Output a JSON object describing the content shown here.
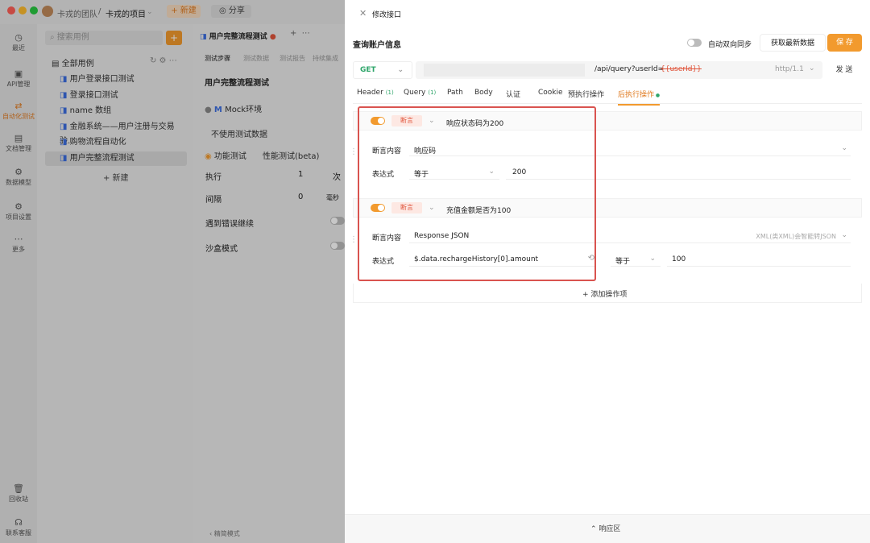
{
  "window": {
    "breadcrumb_team": "卡戎的团队",
    "breadcrumb_sep": "/",
    "project": "卡戎的项目",
    "new_btn": "+ 新建",
    "share_btn": "分享",
    "share_icon": "share-icon"
  },
  "rail": {
    "items": [
      {
        "label": "最近",
        "icon": "clock-icon",
        "glyph": "◷"
      },
      {
        "label": "API管理",
        "icon": "api-icon",
        "glyph": "▣"
      },
      {
        "label": "自动化测试",
        "icon": "auto-test-icon",
        "glyph": "⇄"
      },
      {
        "label": "文档管理",
        "icon": "doc-icon",
        "glyph": "▤"
      },
      {
        "label": "数据模型",
        "icon": "model-icon",
        "glyph": "⚙"
      },
      {
        "label": "项目设置",
        "icon": "settings-icon",
        "glyph": "⚙"
      },
      {
        "label": "更多",
        "icon": "more-icon",
        "glyph": "⋯"
      },
      {
        "label": "回收站",
        "icon": "trash-icon",
        "glyph": "🗑"
      },
      {
        "label": "联系客服",
        "icon": "support-icon",
        "glyph": "☊"
      }
    ]
  },
  "tree": {
    "search_placeholder": "搜索用例",
    "add": "+",
    "root": "全部用例",
    "items": [
      "用户登录接口测试",
      "登录接口测试",
      "name 数组",
      "金融系统——用户注册与交易验...",
      "购物流程自动化",
      "用户完整流程测试"
    ],
    "new": "+ 新建"
  },
  "mid": {
    "tab_title": "用户完整流程测试",
    "tabs": [
      "测试步骤",
      "测试数据",
      "测试报告",
      "持续集成"
    ],
    "heading": "用户完整流程测试",
    "env": "Mock环境",
    "env_badge": "M",
    "data_select": "不使用测试数据",
    "mode_func": "功能测试",
    "mode_perf": "性能测试(beta)",
    "run_label": "执行",
    "run_value": "1",
    "run_unit": "次",
    "interval_label": "间隔",
    "interval_value": "0",
    "interval_unit": "毫秒",
    "on_error": "遇到错误继续",
    "sandbox": "沙盒模式",
    "footer": "精简模式"
  },
  "drawer": {
    "title": "修改接口",
    "name": "查询账户信息",
    "sync_label": "自动双向同步",
    "fetch_btn": "获取最新数据",
    "save_btn": "保 存",
    "method": "GET",
    "url_path": "/api/query?userId=",
    "url_param": "{{userId}}",
    "http": "http/1.1",
    "send": "发 送",
    "tabs": [
      {
        "label": "Header",
        "count": "(1)"
      },
      {
        "label": "Query",
        "count": "(1)"
      },
      {
        "label": "Path",
        "count": ""
      },
      {
        "label": "Body",
        "count": ""
      },
      {
        "label": "认证",
        "count": ""
      },
      {
        "label": "Cookie",
        "count": ""
      },
      {
        "label": "预执行操作",
        "count": ""
      },
      {
        "label": "后执行操作",
        "count": ""
      }
    ],
    "assertions": [
      {
        "tag": "断言",
        "title": "响应状态码为200",
        "content_label": "断言内容",
        "content": "响应码",
        "expr_label": "表达式",
        "op": "等于",
        "value": "200",
        "extra": ""
      },
      {
        "tag": "断言",
        "title": "充值金额是否为100",
        "content_label": "断言内容",
        "content": "Response JSON",
        "expr_label": "表达式",
        "expr": "$.data.rechargeHistory[0].amount",
        "op": "等于",
        "value": "100",
        "extra": "XML(类XML)会智能转JSON"
      }
    ],
    "add_op": "+ 添加操作项",
    "response": "响应区"
  },
  "colors": {
    "accent": "#f29a2e",
    "highlight": "#d9534f",
    "active_tab": "#f29a2e"
  }
}
